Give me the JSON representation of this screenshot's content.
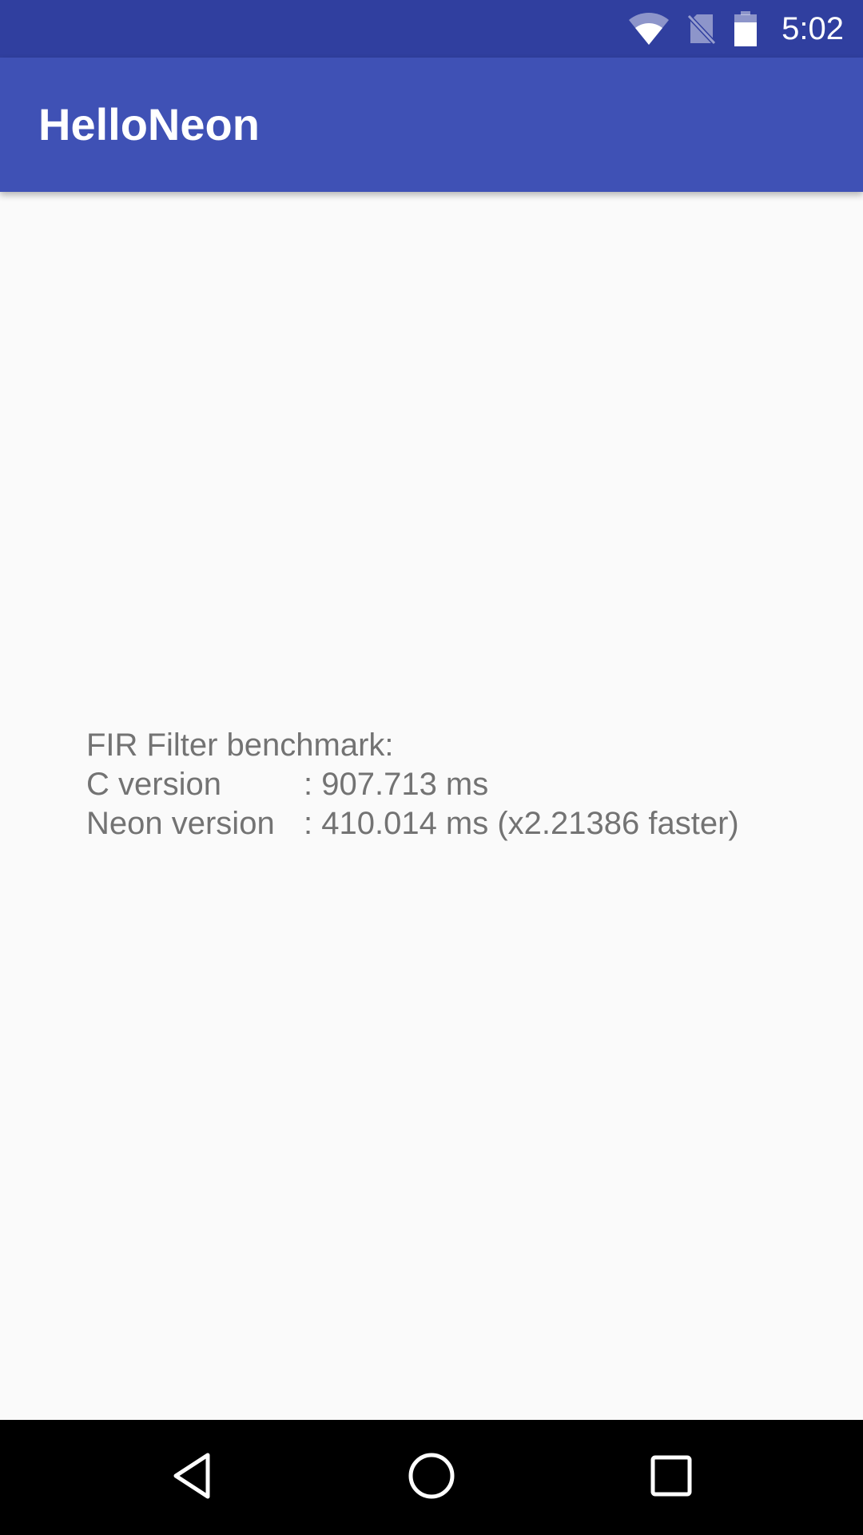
{
  "status_bar": {
    "time": "5:02",
    "icons": [
      "wifi-icon",
      "no-sim-icon",
      "battery-icon"
    ],
    "background_color": "#303f9f"
  },
  "app_bar": {
    "title": "HelloNeon",
    "background_color": "#3f51b5"
  },
  "benchmark": {
    "heading": "FIR Filter benchmark:",
    "rows": [
      {
        "label": "C version",
        "value": ": 907.713 ms"
      },
      {
        "label": "Neon version",
        "value": ": 410.014 ms (x2.21386 faster)"
      }
    ],
    "text_color": "#737373"
  },
  "nav_bar": {
    "buttons": [
      "back-icon",
      "home-icon",
      "recents-icon"
    ],
    "background_color": "#000000"
  }
}
